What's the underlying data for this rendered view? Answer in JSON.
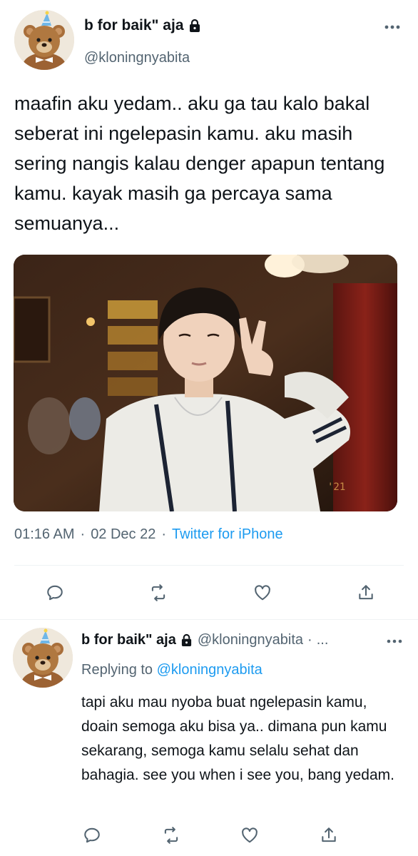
{
  "main_tweet": {
    "display_name": "b for baik\" aja",
    "handle": "@kloningnyabita",
    "text": "maafin aku yedam.. aku ga tau kalo bakal seberat ini ngelepasin kamu. aku masih sering nangis kalau denger apapun tentang kamu. kayak masih ga percaya sama semuanya...",
    "time": "01:16 AM",
    "separator": "·",
    "date": "02 Dec 22",
    "source": "Twitter for iPhone",
    "photo_watermark": "'21",
    "icons": {
      "lock": "lock-icon",
      "more": "more-icon",
      "reply": "reply-icon",
      "retweet": "retweet-icon",
      "like": "heart-icon",
      "share": "share-icon"
    }
  },
  "reply_tweet": {
    "display_name": "b for baik\" aja",
    "handle": "@kloningnyabita",
    "dot": "·",
    "ellipsis": "...",
    "replying_label": "Replying to",
    "replying_mention": "@kloningnyabita",
    "text": "tapi aku mau nyoba buat ngelepasin kamu, doain semoga aku bisa ya.. dimana pun kamu sekarang, semoga kamu selalu sehat dan bahagia. see you when i see you, bang yedam."
  },
  "colors": {
    "text_primary": "#0f1419",
    "text_secondary": "#536471",
    "accent": "#1d9bf0",
    "divider": "#eff3f4"
  }
}
